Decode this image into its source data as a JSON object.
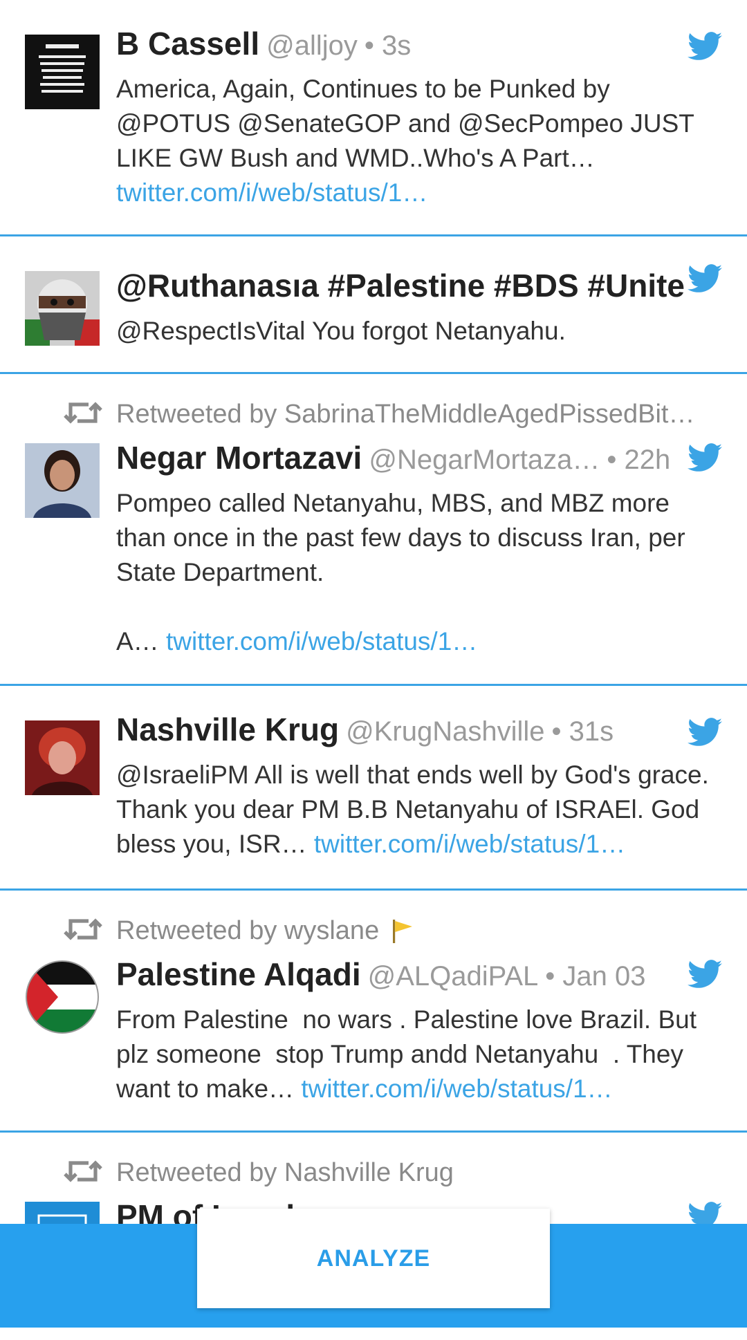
{
  "tweets": [
    {
      "name": "B Cassell",
      "handle": "@alljoy",
      "time": "• 3s",
      "text": "America, Again, Continues to be Punked by @POTUS @SenateGOP and @SecPompeo JUST LIKE GW Bush and WMD..Who's A Part… ",
      "link": "twitter.com/i/web/status/1…"
    },
    {
      "name": "@Ruthanasıa #Palestine #BDS #Unite",
      "handle": "",
      "time": "",
      "text": "@RespectIsVital You forgot Netanyahu.",
      "link": ""
    },
    {
      "retweeted_by": "Retweeted by SabrinaTheMiddleAgedPissedBit…",
      "name": "Negar Mortazavi",
      "handle": "@NegarMortaza…",
      "time": "• 22h",
      "text": "Pompeo called Netanyahu, MBS, and MBZ more than once in the past few days to discuss Iran, per State Department.\n\nA… ",
      "link": "twitter.com/i/web/status/1…"
    },
    {
      "name": "Nashville Krug",
      "handle": "@KrugNashville",
      "time": "• 31s",
      "text": "@IsraeliPM All is well that ends well by God's grace. Thank you dear PM B.B Netanyahu of ISRAEl. God bless you, ISR… ",
      "link": "twitter.com/i/web/status/1…"
    },
    {
      "retweeted_by": "Retweeted by wyslane",
      "name": "Palestine Alqadi",
      "handle": "@ALQadiPAL",
      "time": "• Jan 03",
      "text": "From Palestine  no wars . Palestine love Brazil. But plz someone  stop Trump andd Netanyahu  . They want to make… ",
      "link": "twitter.com/i/web/status/1…"
    },
    {
      "retweeted_by": "Retweeted by Nashville Krug",
      "name": "PM of Israel",
      "handle": "",
      "time": "",
      "text": "",
      "link": ""
    }
  ],
  "analyze_label": "ANALYZE",
  "colors": {
    "accent": "#27a0ee",
    "link": "#3ba4e5"
  },
  "icons": {
    "bird": "twitter-bird-icon",
    "retweet": "retweet-icon"
  }
}
